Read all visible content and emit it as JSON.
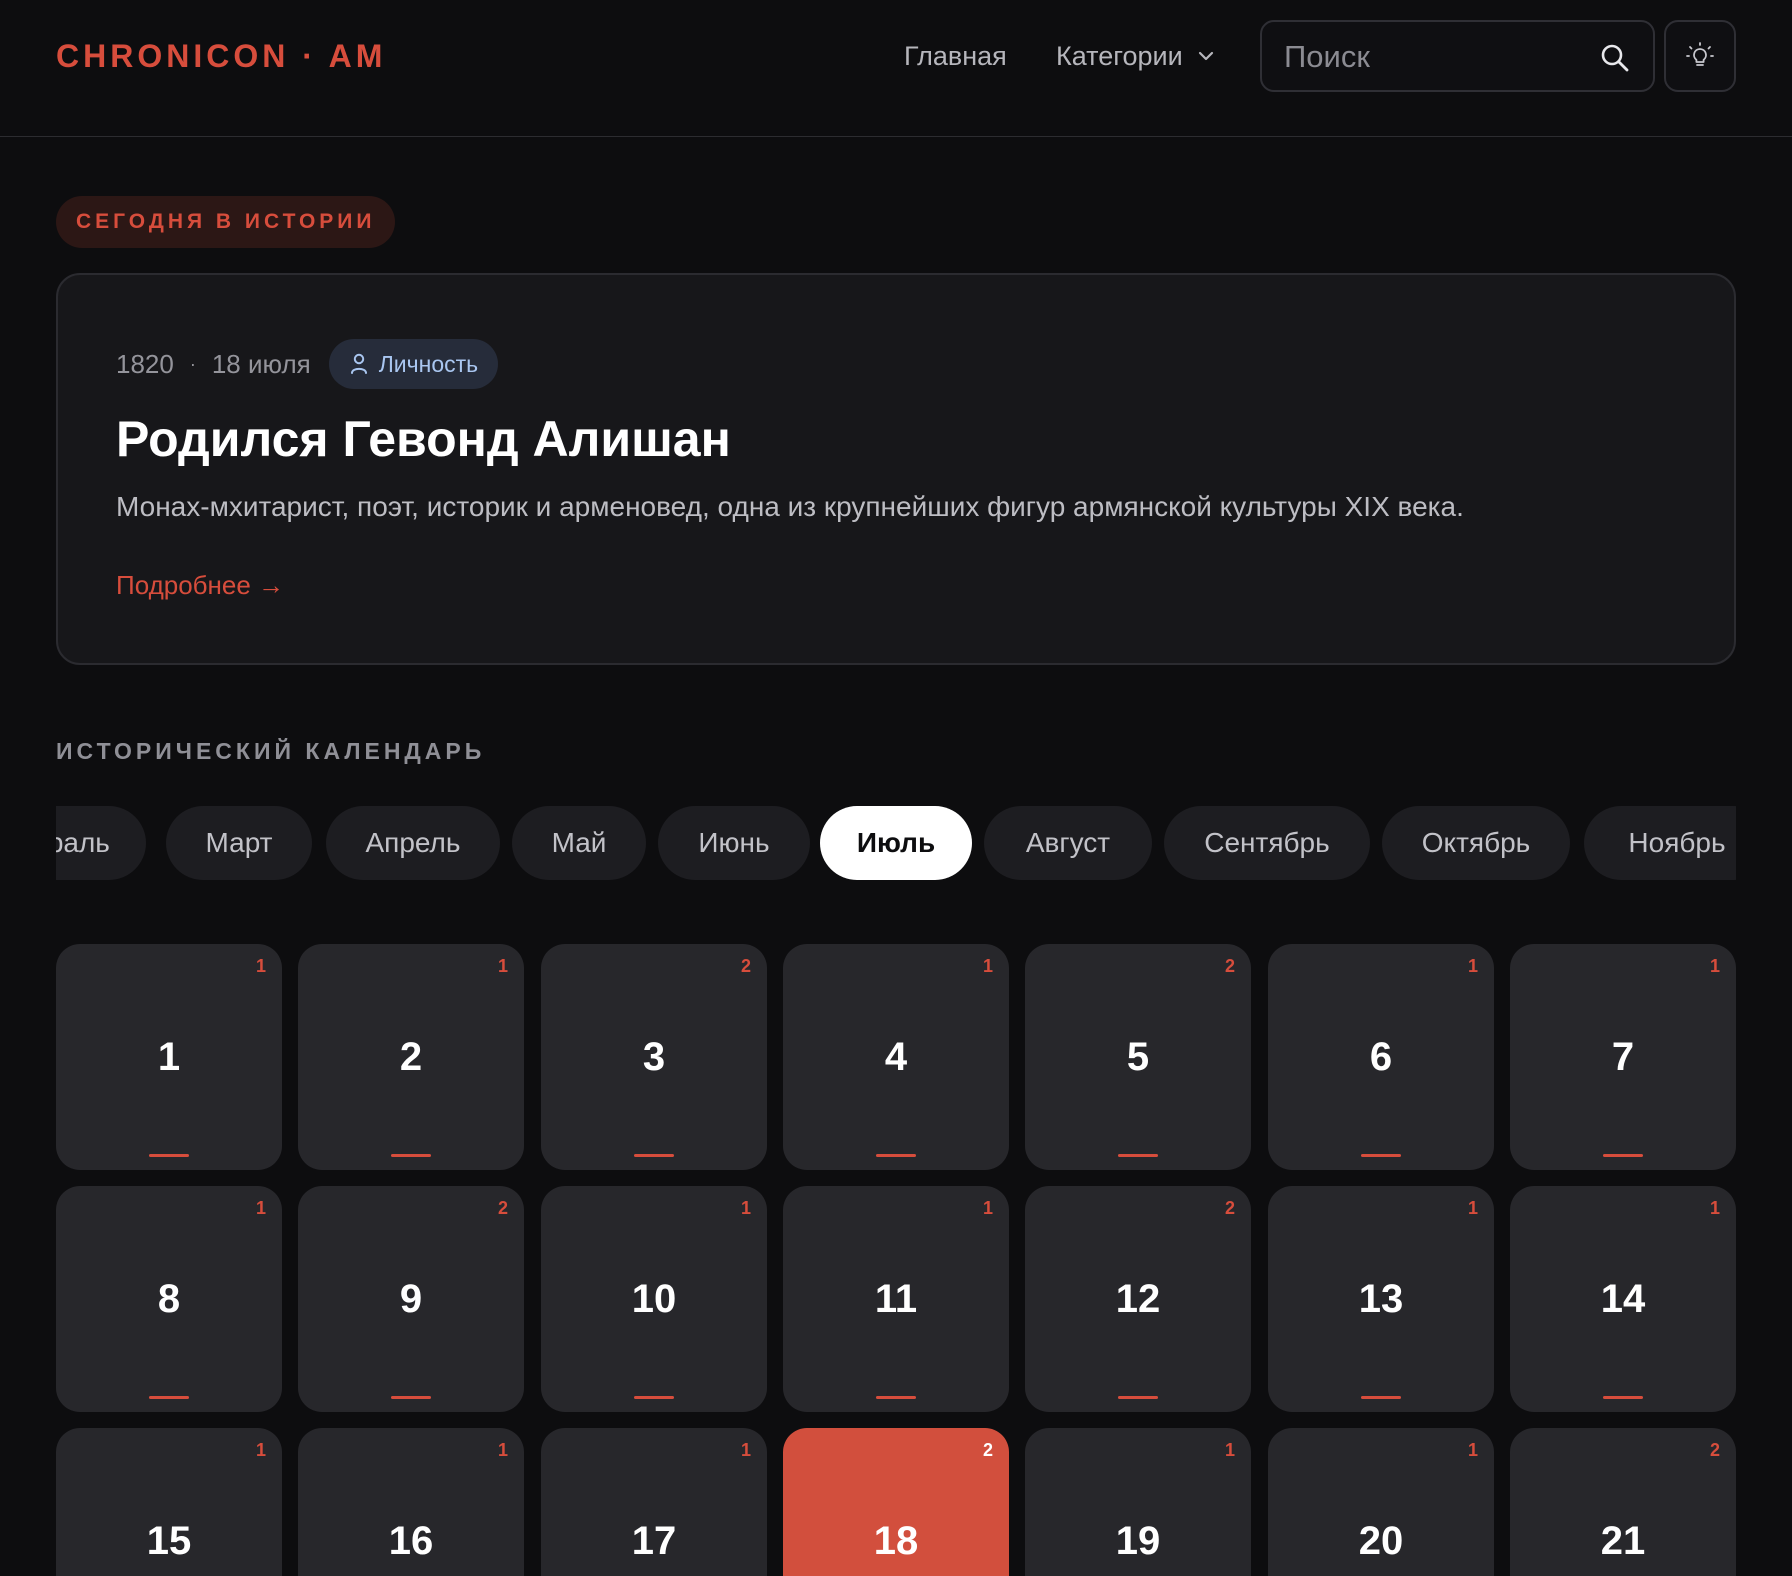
{
  "header": {
    "logo": "CHRONICON · AM",
    "nav_home": "Главная",
    "nav_categories": "Категории",
    "search_placeholder": "Поиск"
  },
  "today": {
    "badge": "СЕГОДНЯ В ИСТОРИИ",
    "year": "1820",
    "date": "18 июля",
    "category": "Личность",
    "title": "Родился Гевонд Алишан",
    "description": "Монах-мхитарист, поэт, историк и арменовед, одна из крупнейших фигур армянской культуры XIX века.",
    "more_link": "Подробнее →"
  },
  "calendar": {
    "title": "ИСТОРИЧЕСКИЙ КАЛЕНДАРЬ",
    "months": [
      "Февраль",
      "Март",
      "Апрель",
      "Май",
      "Июнь",
      "Июль",
      "Август",
      "Сентябрь",
      "Октябрь",
      "Ноябрь"
    ],
    "active_month": "Июль",
    "active_day": 18,
    "days": [
      {
        "day": "1",
        "count": "1"
      },
      {
        "day": "2",
        "count": "1"
      },
      {
        "day": "3",
        "count": "2"
      },
      {
        "day": "4",
        "count": "1"
      },
      {
        "day": "5",
        "count": "2"
      },
      {
        "day": "6",
        "count": "1"
      },
      {
        "day": "7",
        "count": "1"
      },
      {
        "day": "8",
        "count": "1"
      },
      {
        "day": "9",
        "count": "2"
      },
      {
        "day": "10",
        "count": "1"
      },
      {
        "day": "11",
        "count": "1"
      },
      {
        "day": "12",
        "count": "2"
      },
      {
        "day": "13",
        "count": "1"
      },
      {
        "day": "14",
        "count": "1"
      },
      {
        "day": "15",
        "count": "1"
      },
      {
        "day": "16",
        "count": "1"
      },
      {
        "day": "17",
        "count": "1"
      },
      {
        "day": "18",
        "count": "2"
      },
      {
        "day": "19",
        "count": "1"
      },
      {
        "day": "20",
        "count": "1"
      },
      {
        "day": "21",
        "count": "2"
      }
    ]
  },
  "colors": {
    "accent": "#d74d3c",
    "background": "#0d0d0f",
    "card": "#27272b"
  },
  "icons": {
    "search": "search-icon",
    "theme": "lightbulb-icon",
    "chevron": "chevron-down-icon",
    "person": "person-icon"
  }
}
